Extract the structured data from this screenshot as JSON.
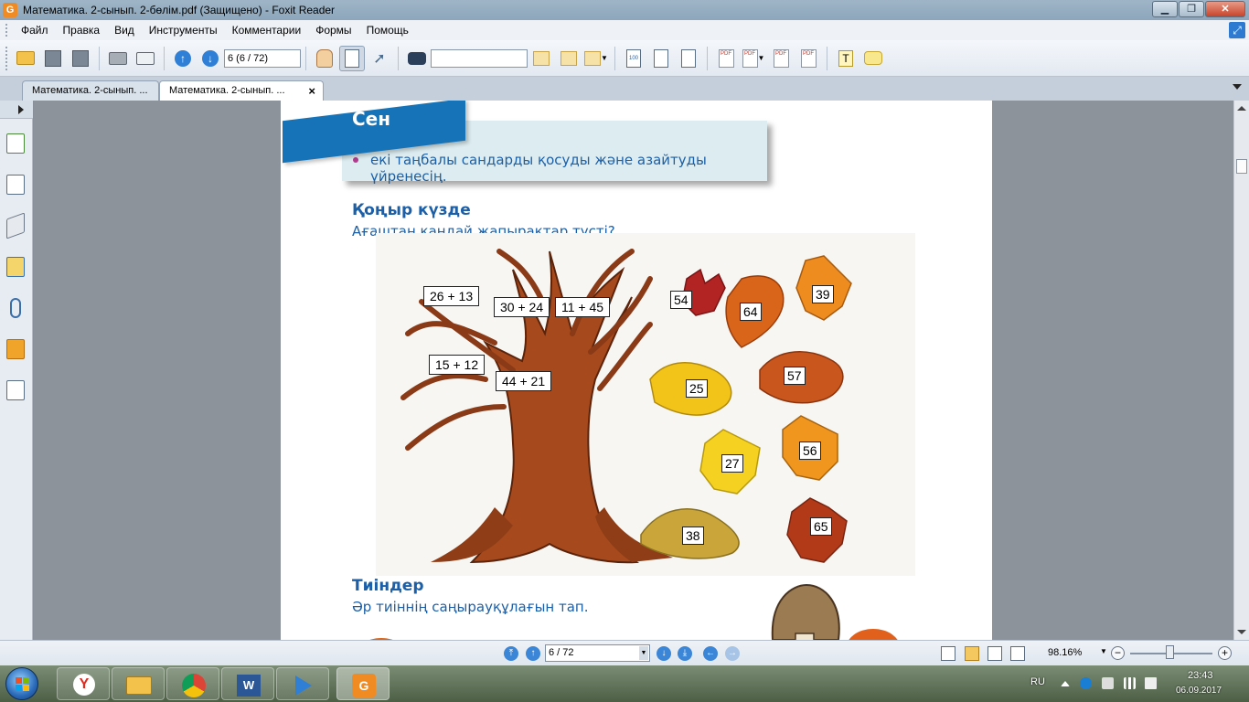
{
  "window": {
    "title": "Математика. 2-сынып. 2-бөлім.pdf (Защищено) - Foxit Reader",
    "app_icon_letter": "G",
    "minimize_label": "▁",
    "maximize_label": "❐",
    "close_label": "✕"
  },
  "menu": {
    "items": [
      "Файл",
      "Правка",
      "Вид",
      "Инструменты",
      "Комментарии",
      "Формы",
      "Помощь"
    ]
  },
  "toolbar": {
    "page_field_value": "6 (6 / 72)",
    "search_field_value": ""
  },
  "tabs": [
    {
      "label": "Математика. 2-сынып. ...",
      "active": false
    },
    {
      "label": "Математика. 2-сынып. ...",
      "active": true,
      "close": "×"
    }
  ],
  "page": {
    "banner_label": "Сен",
    "goal_text": "екі таңбалы сандарды қосуды және азайтуды үйренесің.",
    "section1_title": "Қоңыр күзде",
    "section1_question": "Ағаштан қандай жапырақтар түсті?",
    "tree_expressions": [
      "26 + 13",
      "30 + 24",
      "11 + 45",
      "15 + 12",
      "44 + 21"
    ],
    "leaf_values": [
      "54",
      "64",
      "39",
      "25",
      "57",
      "27",
      "56",
      "38",
      "65"
    ],
    "section2_title": "Тиіндер",
    "section2_question": "Әр тиіннің саңырауқұлағын тап."
  },
  "statusbar": {
    "page_nav_value": "6 / 72",
    "zoom_value": "98.16%"
  },
  "taskbar": {
    "language": "RU",
    "time": "23:43",
    "date": "06.09.2017"
  },
  "colors": {
    "accent_blue": "#1673b7",
    "heading_blue": "#1b5fa8",
    "goal_bg": "#dcecf0",
    "bullet_magenta": "#b23b8f"
  }
}
